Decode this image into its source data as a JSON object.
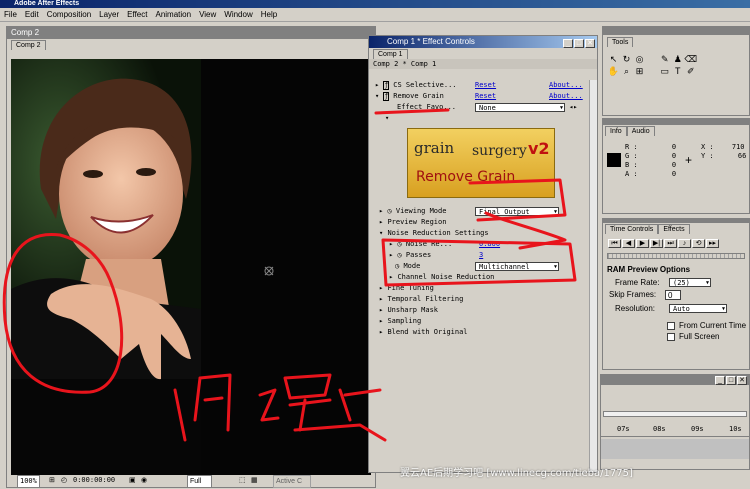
{
  "app": {
    "title": "Adobe After Effects"
  },
  "menu": [
    "File",
    "Edit",
    "Composition",
    "Layer",
    "Effect",
    "Animation",
    "View",
    "Window",
    "Help"
  ],
  "comp_window": {
    "title": "Comp 2",
    "tab": "Comp 2",
    "zoom": "100%",
    "timecode": "0:00:00:00",
    "resolution": "Full",
    "camera": "Active C"
  },
  "effect_controls": {
    "title": "Comp 1 * Effect Controls",
    "tab": "Comp 1",
    "breadcrumb": "Comp 2 * Comp 1",
    "effects": [
      {
        "name": "CS Selective...",
        "reset": "Reset",
        "about": "About..."
      },
      {
        "name": "Remove Grain",
        "reset": "Reset",
        "about": "About..."
      }
    ],
    "effect_favorites_label": "Effect Favo...",
    "effect_favorites_value": "None",
    "plugin_logo": {
      "line1": "grain",
      "line2": "surgery",
      "version": "v2",
      "caption": "Remove Grain"
    },
    "viewing_mode_label": "Viewing Mode",
    "viewing_mode_value": "Final Output",
    "preview_region": "Preview Region",
    "noise_reduction_settings": "Noise Reduction Settings",
    "noise_re_label": "Noise Re...",
    "noise_re_value": "0.800",
    "passes_label": "Passes",
    "passes_value": "3",
    "mode_label": "Mode",
    "mode_value": "Multichannel",
    "channel_noise": "Channel Noise Reduction",
    "groups": [
      "Fine Tuning",
      "Temporal Filtering",
      "Unsharp Mask",
      "Sampling",
      "Blend with Original"
    ]
  },
  "tools": {
    "title": "Tools"
  },
  "info": {
    "tabs": [
      "Info",
      "Audio"
    ],
    "rgba": [
      {
        "k": "R",
        "v": "0"
      },
      {
        "k": "G",
        "v": "0"
      },
      {
        "k": "B",
        "v": "0"
      },
      {
        "k": "A",
        "v": "0"
      }
    ],
    "x_label": "X",
    "x": "710",
    "y_label": "Y",
    "y": "66"
  },
  "time_controls": {
    "tabs": [
      "Time Controls",
      "Effects"
    ],
    "ram_title": "RAM Preview Options",
    "frame_rate_label": "Frame Rate:",
    "frame_rate_value": "(25)",
    "skip_frames_label": "Skip Frames:",
    "skip_frames_value": "0",
    "resolution_label": "Resolution:",
    "resolution_value": "Auto",
    "from_current_time": "From Current Time",
    "full_screen": "Full Screen"
  },
  "timeline": {
    "ticks": [
      "07s",
      "08s",
      "09s",
      "10s"
    ]
  },
  "annotation": {
    "handwritten": "问题"
  },
  "watermark": "翼云AE后期学习吧 [www.linecg.com/tieba/1775]",
  "colors": {
    "annotation_red": "#e8141c",
    "title_blue": "#0a246a",
    "link_blue": "#0000cc"
  }
}
